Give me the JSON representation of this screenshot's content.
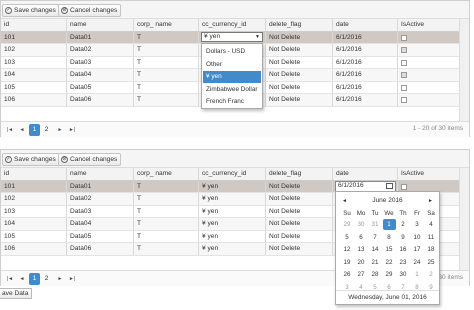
{
  "grid1": {
    "save": "Save changes",
    "cancel": "Cancel changes",
    "pager_info": "1 - 20 of 30 items",
    "page": "1",
    "page_next": "2"
  },
  "grid2": {
    "save": "Save changes",
    "cancel": "Cancel changes",
    "pager_info": "1 - 20 of 30 items",
    "pager_info_visible": "/ 30 items",
    "page": "1",
    "page_next": "2"
  },
  "columns": [
    "id",
    "name",
    "corp_ name",
    "cc_currency_id",
    "delete_flag",
    "date",
    "IsActive"
  ],
  "rows1": [
    {
      "id": "101",
      "name": "Data01",
      "corp": "T",
      "cur": "¥ yen",
      "del": "Not Delete",
      "date": "6/1/2016",
      "active": false
    },
    {
      "id": "102",
      "name": "Data02",
      "corp": "T",
      "cur": "",
      "del": "Not Delete",
      "date": "6/1/2016",
      "active": true
    },
    {
      "id": "103",
      "name": "Data03",
      "corp": "T",
      "cur": "",
      "del": "Not Delete",
      "date": "6/1/2016",
      "active": false
    },
    {
      "id": "104",
      "name": "Data04",
      "corp": "T",
      "cur": "",
      "del": "Not Delete",
      "date": "6/1/2016",
      "active": true
    },
    {
      "id": "105",
      "name": "Data05",
      "corp": "T",
      "cur": "",
      "del": "Not Delete",
      "date": "6/1/2016",
      "active": false
    },
    {
      "id": "106",
      "name": "Data06",
      "corp": "T",
      "cur": "",
      "del": "Not Delete",
      "date": "6/1/2016",
      "active": false
    }
  ],
  "rows2": [
    {
      "id": "101",
      "name": "Data01",
      "corp": "T",
      "cur": "¥ yen",
      "del": "Not Delete",
      "date": "6/1/2016",
      "active": false
    },
    {
      "id": "102",
      "name": "Data02",
      "corp": "T",
      "cur": "¥ yen",
      "del": "Not Delete",
      "date": "",
      "active": false
    },
    {
      "id": "103",
      "name": "Data03",
      "corp": "T",
      "cur": "¥ yen",
      "del": "Not Delete",
      "date": "",
      "active": false
    },
    {
      "id": "104",
      "name": "Data04",
      "corp": "T",
      "cur": "¥ yen",
      "del": "Not Delete",
      "date": "",
      "active": false
    },
    {
      "id": "105",
      "name": "Data05",
      "corp": "T",
      "cur": "¥ yen",
      "del": "Not Delete",
      "date": "",
      "active": false
    },
    {
      "id": "106",
      "name": "Data06",
      "corp": "T",
      "cur": "¥ yen",
      "del": "Not Delete",
      "date": "",
      "active": false
    }
  ],
  "dropdown": {
    "value": "¥ yen",
    "options": [
      "Dollars - USD",
      "Other",
      "¥ yen",
      "Zimbabwee Dollar",
      "French Franc"
    ],
    "selected": 2
  },
  "datepicker": {
    "value": "6/1/2016",
    "month": "June 2016",
    "days": [
      "Su",
      "Mo",
      "Tu",
      "We",
      "Th",
      "Fr",
      "Sa"
    ],
    "weeks": [
      [
        "29",
        "30",
        "31",
        "1",
        "2",
        "3",
        "4"
      ],
      [
        "5",
        "6",
        "7",
        "8",
        "9",
        "10",
        "11"
      ],
      [
        "12",
        "13",
        "14",
        "15",
        "16",
        "17",
        "18"
      ],
      [
        "19",
        "20",
        "21",
        "22",
        "23",
        "24",
        "25"
      ],
      [
        "26",
        "27",
        "28",
        "29",
        "30",
        "1",
        "2"
      ],
      [
        "3",
        "4",
        "5",
        "6",
        "7",
        "8",
        "9"
      ]
    ],
    "footer": "Wednesday, June 01, 2016",
    "prev": "◄",
    "next": "►"
  },
  "bottom_button": "ave Data"
}
